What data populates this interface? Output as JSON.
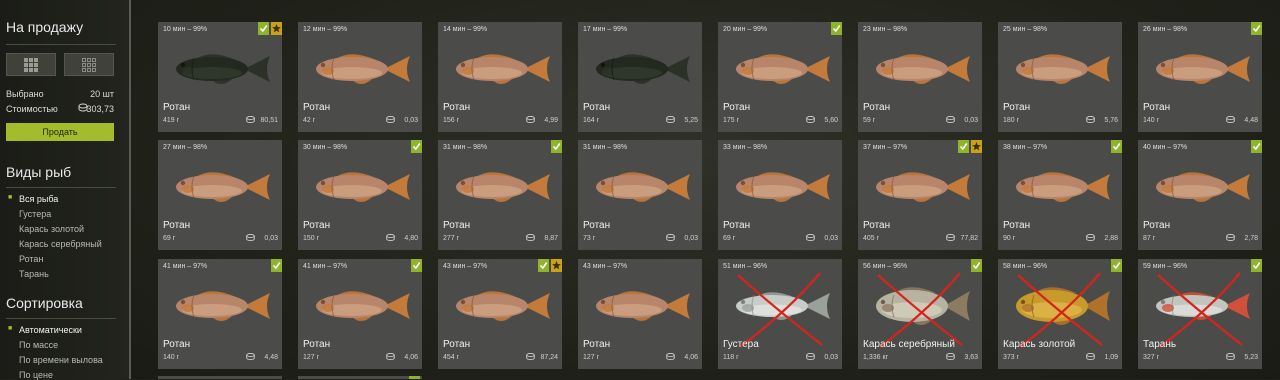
{
  "sidebar": {
    "for_sale_title": "На продажу",
    "selected_label": "Выбрано",
    "selected_value": "20 шт",
    "cost_label": "Стоимостью",
    "cost_value": "303,73",
    "sell_button": "Продать",
    "fish_types_title": "Виды рыб",
    "fish_types": [
      "Вся рыба",
      "Густера",
      "Карась золотой",
      "Карась серебряный",
      "Ротан",
      "Тарань"
    ],
    "sort_title": "Сортировка",
    "sort_options": [
      "Автоматически",
      "По массе",
      "По времени вылова",
      "По цене"
    ]
  },
  "colors": {
    "accent": "#a3bc2c",
    "card_bg": "#4b4c49",
    "cross": "#d8231d",
    "star": "#e0b020"
  },
  "cards": [
    {
      "time": "10 мин – 99%",
      "name": "Ротан",
      "weight": "419 г",
      "price": "80,51",
      "fish": "dark",
      "check": true,
      "star": true,
      "cross": false
    },
    {
      "time": "12 мин – 99%",
      "name": "Ротан",
      "weight": "42 г",
      "price": "0,03",
      "fish": "rotan",
      "check": false,
      "star": false,
      "cross": false
    },
    {
      "time": "14 мин – 99%",
      "name": "Ротан",
      "weight": "156 г",
      "price": "4,99",
      "fish": "rotan",
      "check": false,
      "star": false,
      "cross": false
    },
    {
      "time": "17 мин – 99%",
      "name": "Ротан",
      "weight": "164 г",
      "price": "5,25",
      "fish": "dark",
      "check": false,
      "star": false,
      "cross": false
    },
    {
      "time": "20 мин – 99%",
      "name": "Ротан",
      "weight": "175 г",
      "price": "5,60",
      "fish": "rotan",
      "check": true,
      "star": false,
      "cross": false
    },
    {
      "time": "23 мин – 98%",
      "name": "Ротан",
      "weight": "59 г",
      "price": "0,03",
      "fish": "rotan",
      "check": false,
      "star": false,
      "cross": false
    },
    {
      "time": "25 мин – 98%",
      "name": "Ротан",
      "weight": "180 г",
      "price": "5,76",
      "fish": "rotan",
      "check": false,
      "star": false,
      "cross": false
    },
    {
      "time": "26 мин – 98%",
      "name": "Ротан",
      "weight": "140 г",
      "price": "4,48",
      "fish": "rotan",
      "check": true,
      "star": false,
      "cross": false
    },
    {
      "time": "27 мин – 98%",
      "name": "Ротан",
      "weight": "69 г",
      "price": "0,03",
      "fish": "rotan",
      "check": false,
      "star": false,
      "cross": false
    },
    {
      "time": "30 мин – 98%",
      "name": "Ротан",
      "weight": "150 г",
      "price": "4,80",
      "fish": "rotan",
      "check": true,
      "star": false,
      "cross": false
    },
    {
      "time": "31 мин – 98%",
      "name": "Ротан",
      "weight": "277 г",
      "price": "8,87",
      "fish": "rotan",
      "check": true,
      "star": false,
      "cross": false
    },
    {
      "time": "31 мин – 98%",
      "name": "Ротан",
      "weight": "73 г",
      "price": "0,03",
      "fish": "rotan",
      "check": false,
      "star": false,
      "cross": false
    },
    {
      "time": "33 мин – 98%",
      "name": "Ротан",
      "weight": "69 г",
      "price": "0,03",
      "fish": "rotan",
      "check": false,
      "star": false,
      "cross": false
    },
    {
      "time": "37 мин – 97%",
      "name": "Ротан",
      "weight": "405 г",
      "price": "77,82",
      "fish": "rotan",
      "check": true,
      "star": true,
      "cross": false
    },
    {
      "time": "38 мин – 97%",
      "name": "Ротан",
      "weight": "90 г",
      "price": "2,88",
      "fish": "rotan",
      "check": true,
      "star": false,
      "cross": false
    },
    {
      "time": "40 мин – 97%",
      "name": "Ротан",
      "weight": "87 г",
      "price": "2,78",
      "fish": "rotan",
      "check": true,
      "star": false,
      "cross": false
    },
    {
      "time": "41 мин – 97%",
      "name": "Ротан",
      "weight": "140 г",
      "price": "4,48",
      "fish": "rotan",
      "check": true,
      "star": false,
      "cross": false
    },
    {
      "time": "41 мин – 97%",
      "name": "Ротан",
      "weight": "127 г",
      "price": "4,06",
      "fish": "rotan",
      "check": true,
      "star": false,
      "cross": false
    },
    {
      "time": "43 мин – 97%",
      "name": "Ротан",
      "weight": "454 г",
      "price": "87,24",
      "fish": "rotan",
      "check": true,
      "star": true,
      "cross": false
    },
    {
      "time": "43 мин – 97%",
      "name": "Ротан",
      "weight": "127 г",
      "price": "4,06",
      "fish": "rotan",
      "check": false,
      "star": false,
      "cross": false
    },
    {
      "time": "51 мин – 96%",
      "name": "Густера",
      "weight": "118 г",
      "price": "0,03",
      "fish": "silver",
      "check": false,
      "star": false,
      "cross": true
    },
    {
      "time": "56 мин – 96%",
      "name": "Карась серебряный",
      "weight": "1,336 кг",
      "price": "3,63",
      "fish": "carp",
      "check": true,
      "star": false,
      "cross": true
    },
    {
      "time": "58 мин – 96%",
      "name": "Карась золотой",
      "weight": "373 г",
      "price": "1,09",
      "fish": "gold",
      "check": true,
      "star": false,
      "cross": true
    },
    {
      "time": "59 мин – 96%",
      "name": "Тарань",
      "weight": "327 г",
      "price": "5,23",
      "fish": "roach",
      "check": true,
      "star": false,
      "cross": true
    }
  ]
}
